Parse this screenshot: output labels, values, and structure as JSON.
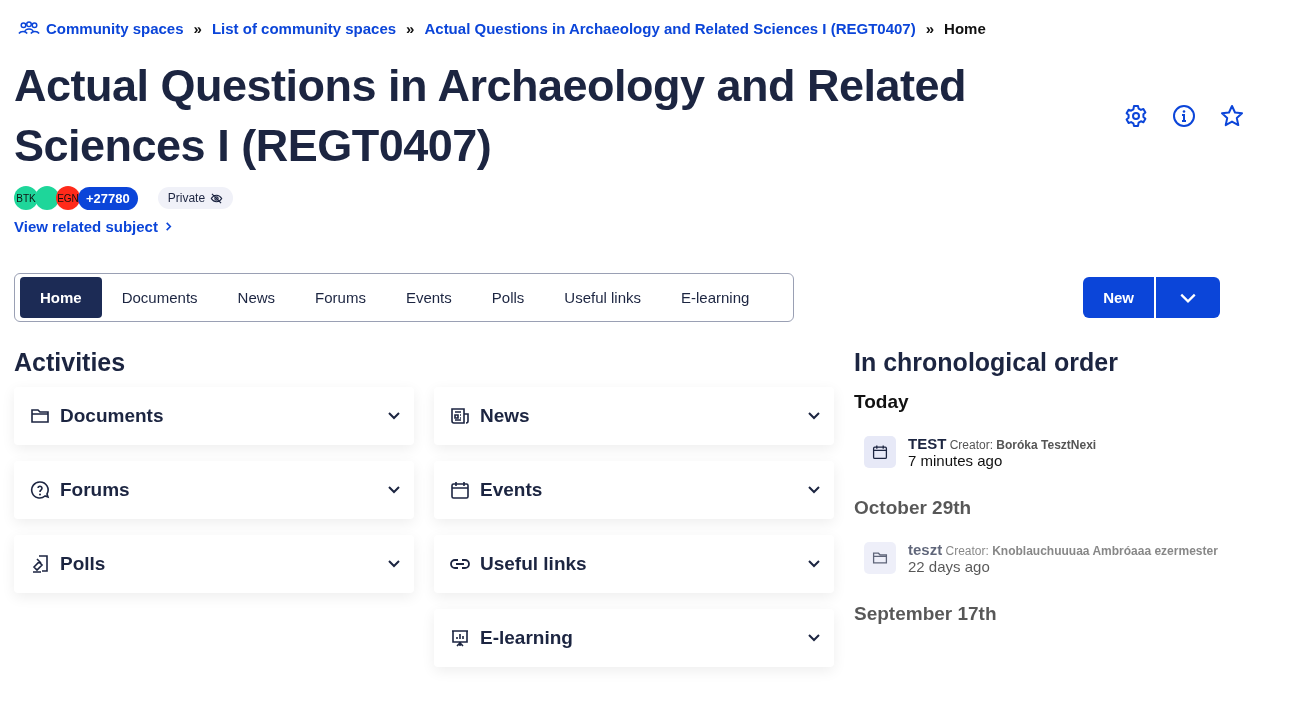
{
  "breadcrumb": [
    {
      "label": "Community spaces",
      "kind": "community",
      "current": false
    },
    {
      "label": "List of community spaces",
      "separator": "»",
      "current": false
    },
    {
      "label": "Actual Questions in Archaeology and Related Sciences I (REGT0407)",
      "separator": "»",
      "current": false
    },
    {
      "label": "Home",
      "separator": "»",
      "current": true
    }
  ],
  "title": "Actual Questions in Archaeology and Related Sciences I (REGT0407)",
  "members": {
    "avatars": [
      {
        "label": "BTK",
        "color": "#1ed69a"
      },
      {
        "color": "#1ed69a"
      },
      {
        "label": "EGN",
        "color": "#ff2a1a"
      }
    ],
    "count": "+27780"
  },
  "visibility": {
    "label": "Private",
    "hidden": true
  },
  "related_link": "View related subject",
  "tabs": [
    {
      "label": "Home",
      "selected": true
    },
    {
      "label": "Documents",
      "selected": false
    },
    {
      "label": "News",
      "selected": false
    },
    {
      "label": "Forums",
      "selected": false
    },
    {
      "label": "Events",
      "selected": false
    },
    {
      "label": "Polls",
      "selected": false
    },
    {
      "label": "Useful links",
      "selected": false
    },
    {
      "label": "E-learning",
      "selected": false
    }
  ],
  "new_button": "New",
  "activities": {
    "title": "Activities",
    "columns": [
      [
        {
          "label": "Documents",
          "kind": "folder"
        },
        {
          "label": "Forums",
          "kind": "forum"
        },
        {
          "label": "Polls",
          "kind": "poll"
        }
      ],
      [
        {
          "label": "News",
          "kind": "news"
        },
        {
          "label": "Events",
          "kind": "event"
        },
        {
          "label": "Useful links",
          "kind": "link"
        },
        {
          "label": "E-learning",
          "kind": "elearning"
        }
      ]
    ]
  },
  "timeline": {
    "title": "In chronological order",
    "groups": [
      {
        "date": "Today",
        "dimmed": false,
        "items": [
          {
            "kind": "event",
            "title": "TEST",
            "creator_label": "Creator:",
            "creator": "Boróka TesztNexi",
            "time": "7 minutes ago"
          }
        ]
      },
      {
        "date": "October 29th",
        "dimmed": true,
        "items": [
          {
            "kind": "folder",
            "title": "teszt",
            "creator_label": "Creator:",
            "creator": "Knoblauchuuuaa Ambróaaa ezermester",
            "time": "22 days ago"
          }
        ]
      },
      {
        "date": "September 17th",
        "dimmed": true
      }
    ]
  }
}
